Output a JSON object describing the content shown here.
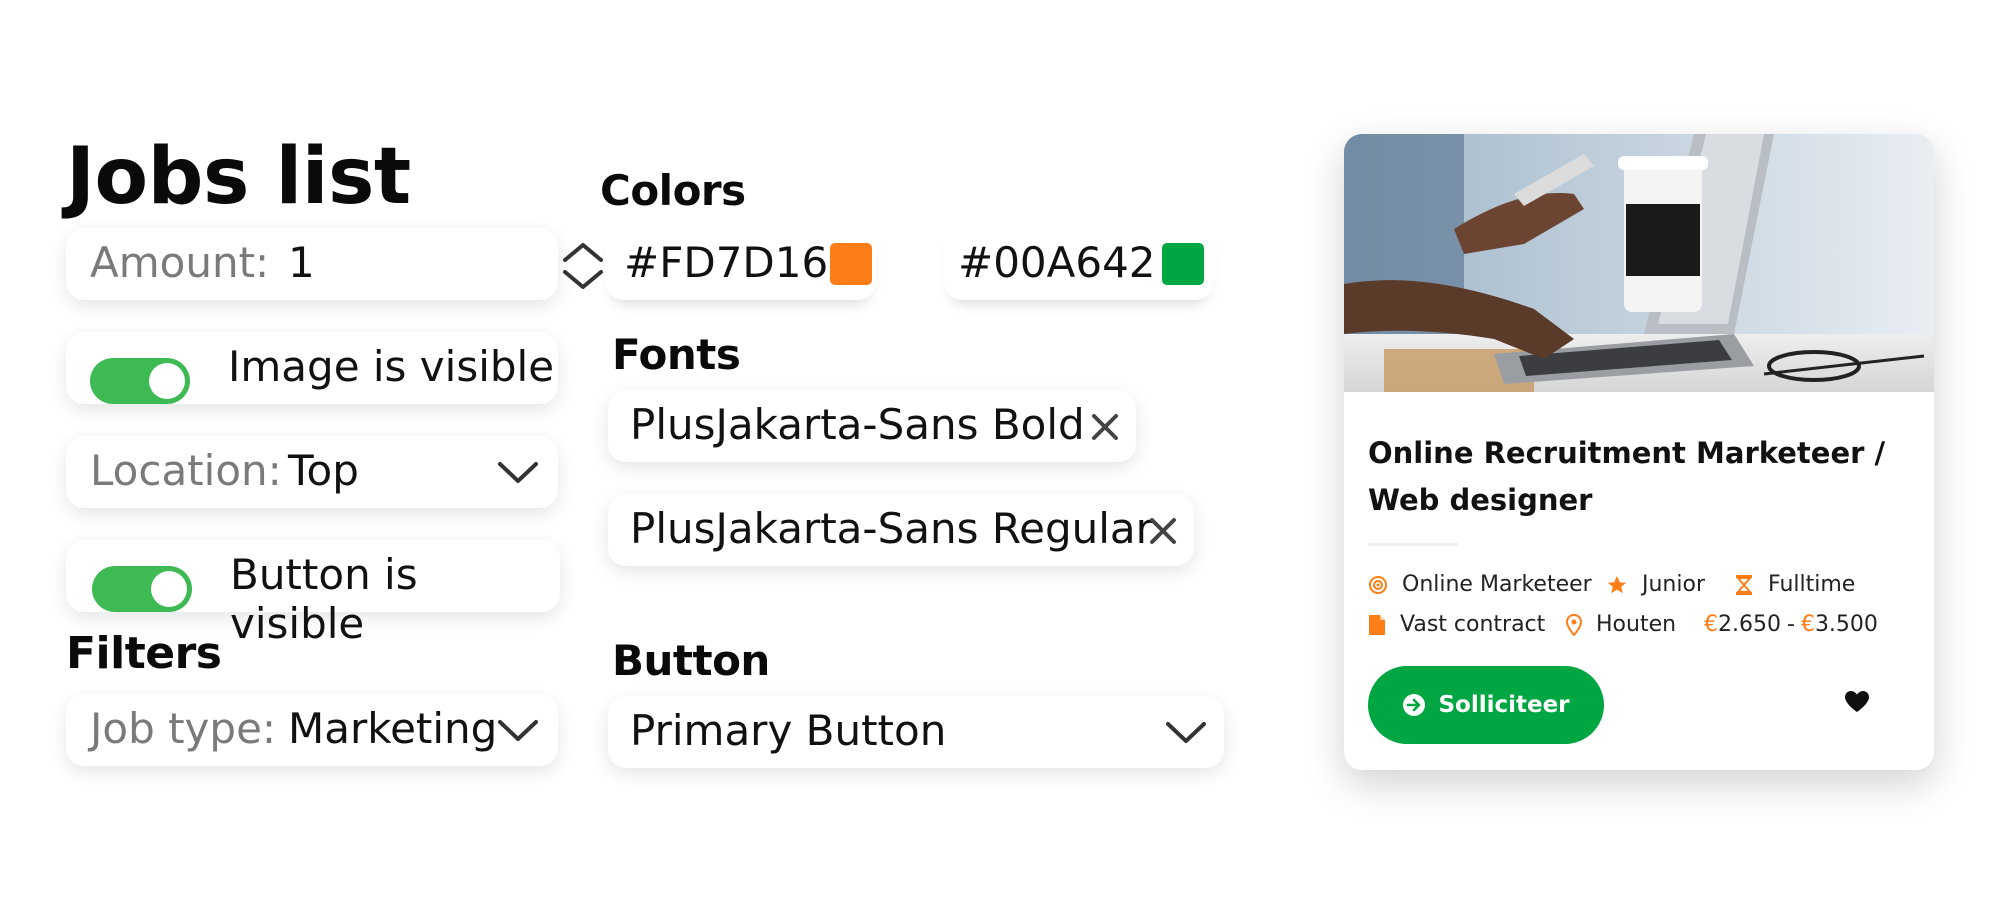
{
  "title": "Jobs list",
  "amount": {
    "label": "Amount:",
    "value": "1"
  },
  "image_toggle": {
    "label": "Image is visible",
    "on": true
  },
  "location": {
    "label": "Location:",
    "value": "Top"
  },
  "button_toggle": {
    "label": "Button is visible",
    "on": true
  },
  "filters": {
    "heading": "Filters",
    "job_type": {
      "label": "Job type:",
      "value": "Marketing"
    }
  },
  "colors": {
    "heading": "Colors",
    "primary": {
      "hex": "#FD7D16"
    },
    "secondary": {
      "hex": "#00A642"
    }
  },
  "fonts": {
    "heading": "Fonts",
    "items": [
      {
        "name": "PlusJakarta-Sans Bold"
      },
      {
        "name": "PlusJakarta-Sans Regular"
      }
    ]
  },
  "button_setting": {
    "heading": "Button",
    "value": "Primary Button"
  },
  "job_card": {
    "title_line1": "Online Recruitment Marketeer /",
    "title_line2": "Web designer",
    "category": "Online Marketeer",
    "level": "Junior",
    "hours": "Fulltime",
    "contract": "Vast contract",
    "location": "Houten",
    "currency": "€",
    "salary_min": "2.650",
    "salary_sep": "-",
    "salary_max": "3.500",
    "apply_label": "Solliciteer",
    "icons": [
      "target-icon",
      "star-icon",
      "hourglass-icon",
      "document-icon",
      "location-pin-icon",
      "arrow-right-circle-icon",
      "heart-icon"
    ],
    "accent": "#FD7D16",
    "button_color": "#00A642"
  }
}
